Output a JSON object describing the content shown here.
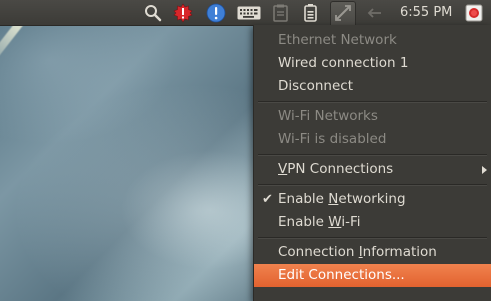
{
  "panel": {
    "clock": "6:55 PM",
    "indicators": [
      {
        "icon": "search-icon"
      },
      {
        "icon": "update-notifier-icon"
      },
      {
        "icon": "info-icon"
      },
      {
        "icon": "keyboard-icon"
      },
      {
        "icon": "clipboard-icon"
      },
      {
        "icon": "battery-icon"
      },
      {
        "icon": "network-icon"
      },
      {
        "icon": "volume-icon"
      },
      {
        "icon": "session-icon"
      }
    ]
  },
  "menu": {
    "items": [
      {
        "label": "Ethernet Network",
        "disabled": true
      },
      {
        "label": "Wired connection 1",
        "disabled": false
      },
      {
        "label": "Disconnect",
        "disabled": false
      },
      {
        "label": "Wi-Fi Networks",
        "disabled": true
      },
      {
        "label": "Wi-Fi is disabled",
        "disabled": true
      },
      {
        "label_pre": "",
        "label_mnemonic": "V",
        "label_post": "PN Connections",
        "disabled": false,
        "submenu": true
      },
      {
        "label_pre": "Enable ",
        "label_mnemonic": "N",
        "label_post": "etworking",
        "disabled": false,
        "checked": true
      },
      {
        "label_pre": "Enable ",
        "label_mnemonic": "W",
        "label_post": "i-Fi",
        "disabled": false
      },
      {
        "label_pre": "Connection ",
        "label_mnemonic": "I",
        "label_post": "nformation",
        "disabled": false
      },
      {
        "label": "Edit Connections...",
        "disabled": false,
        "highlighted": true
      }
    ]
  },
  "colors": {
    "panel": "#3c3b37",
    "menu_text": "#dfdbd2",
    "disabled_text": "#8c8a84",
    "highlight": "#e9703e"
  }
}
